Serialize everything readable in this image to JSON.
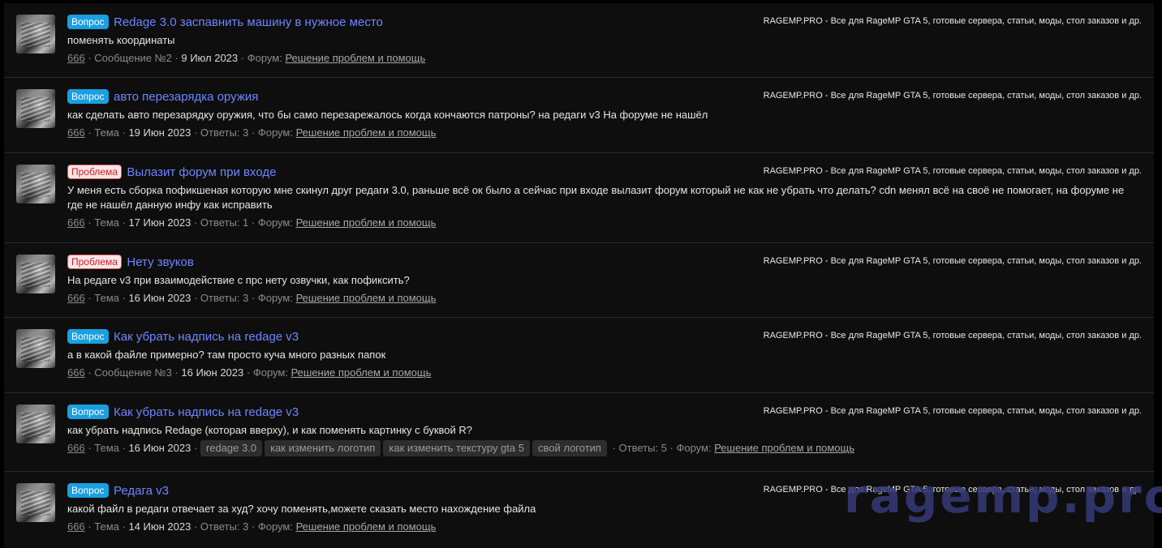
{
  "site_text": "RAGEMP.PRO - Все для RageMP GTA 5, готовые сервера, статьи, моды, стол заказов и др.",
  "watermark": "ragemp.pro",
  "results": [
    {
      "label": "Вопрос",
      "title": "Redage 3.0 заспавнить машину в нужное место",
      "snippet": "поменять координаты",
      "author": "666",
      "kind": "Сообщение №2",
      "date": "9 Июл 2023",
      "forum_prefix": "Форум:",
      "forum": "Решение проблем и помощь"
    },
    {
      "label": "Вопрос",
      "title": "авто перезарядка оружия",
      "snippet": "как сделать авто перезарядку оружия, что бы само перезарежалось когда кончаются патроны? на редаги v3 На форуме не нашёл",
      "author": "666",
      "kind": "Тема",
      "date": "19 Июн 2023",
      "replies": "Ответы: 3",
      "forum_prefix": "Форум:",
      "forum": "Решение проблем и помощь"
    },
    {
      "label": "Проблема",
      "title": "Вылазит форум при входе",
      "snippet": "У меня есть сборка пофикшеная которую мне скинул друг редаги 3.0, раньше всё ок было а сейчас при входе вылазит форум который не как не убрать что делать? cdn менял всё на своё не помогает, на форуме не где не нашёл данную инфу как исправить",
      "author": "666",
      "kind": "Тема",
      "date": "17 Июн 2023",
      "replies": "Ответы: 1",
      "forum_prefix": "Форум:",
      "forum": "Решение проблем и помощь"
    },
    {
      "label": "Проблема",
      "title": "Нету звуков",
      "snippet": "На редаге v3 при взаимодействие с прс нету озвучки, как пофиксить?",
      "author": "666",
      "kind": "Тема",
      "date": "16 Июн 2023",
      "replies": "Ответы: 3",
      "forum_prefix": "Форум:",
      "forum": "Решение проблем и помощь"
    },
    {
      "label": "Вопрос",
      "title": "Как убрать надпись на redage v3",
      "snippet": "а в какой файле примерно? там просто куча много разных папок",
      "author": "666",
      "kind": "Сообщение №3",
      "date": "16 Июн 2023",
      "forum_prefix": "Форум:",
      "forum": "Решение проблем и помощь"
    },
    {
      "label": "Вопрос",
      "title": "Как убрать надпись на redage v3",
      "snippet": "как убрать надпись Redage (которая вверху), и как поменять картинку с буквой R?",
      "author": "666",
      "kind": "Тема",
      "date": "16 Июн 2023",
      "tags": [
        "redage 3.0",
        "как изменить логотип",
        "как изменить текстуру gta 5",
        "свой логотип"
      ],
      "replies": "Ответы: 5",
      "forum_prefix": "Форум:",
      "forum": "Решение проблем и помощь"
    },
    {
      "label": "Вопрос",
      "title": "Редага v3",
      "snippet": "какой файл в редаги отвечает за худ? хочу поменять,можете сказать место нахождение файла",
      "author": "666",
      "kind": "Тема",
      "date": "14 Июн 2023",
      "replies": "Ответы: 3",
      "forum_prefix": "Форум:",
      "forum": "Решение проблем и помощь"
    }
  ]
}
